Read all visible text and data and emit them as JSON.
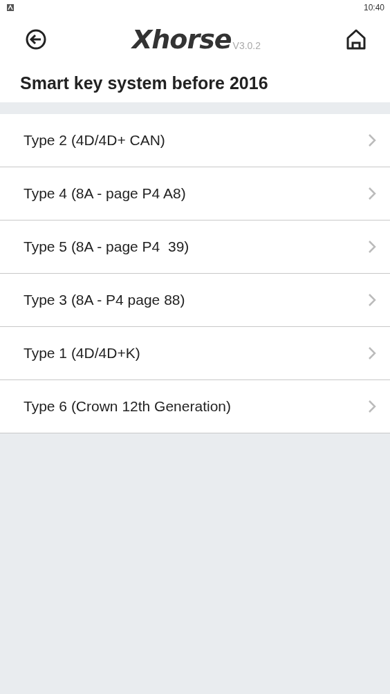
{
  "status_bar": {
    "time": "10:40"
  },
  "header": {
    "logo": "Xhorse",
    "version": "V3.0.2"
  },
  "title": "Smart key system before 2016",
  "items": [
    {
      "label": "Type 2 (4D/4D+ CAN)"
    },
    {
      "label": "Type 4 (8A - page P4 A8)"
    },
    {
      "label": "Type 5 (8A - page P4  39)"
    },
    {
      "label": "Type 3 (8A - P4 page 88)"
    },
    {
      "label": "Type 1 (4D/4D+K)"
    },
    {
      "label": "Type 6 (Crown 12th Generation)"
    }
  ]
}
